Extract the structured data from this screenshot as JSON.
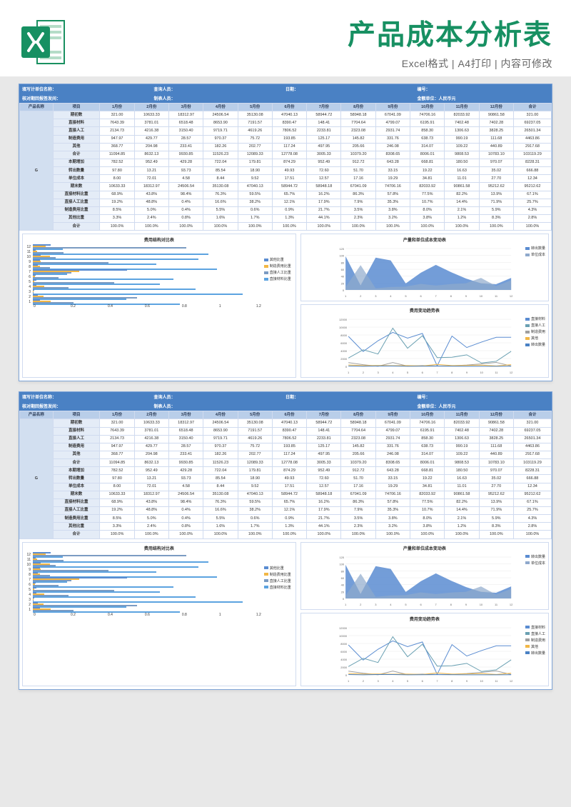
{
  "header": {
    "title": "产品成本分析表",
    "subtitle": "Excel格式 | A4打印 | 内容可修改",
    "icon_name": "excel-icon"
  },
  "band": {
    "a": "填写计单位名称：",
    "b": "查询人员：",
    "c": "日期：",
    "d": "编号：",
    "e": "核对期回报签发间：",
    "f": "制表人员：",
    "g": "",
    "h": "金额单位：人民币元"
  },
  "columns": [
    "产品名称",
    "项目",
    "1月份",
    "2月份",
    "3月份",
    "4月份",
    "5月份",
    "6月份",
    "7月份",
    "8月份",
    "9月份",
    "10月份",
    "11月份",
    "12月份",
    "合计"
  ],
  "product": "G",
  "rows": [
    {
      "n": "期初数",
      "v": [
        "321.00",
        "10633.33",
        "18312.97",
        "24506.54",
        "35130.08",
        "47040.13",
        "58944.72",
        "58948.18",
        "67041.09",
        "74706.16",
        "82033.92",
        "90861.58",
        "321.00"
      ]
    },
    {
      "n": "直接材料",
      "v": [
        "7643.39",
        "3781.01",
        "6518.48",
        "8653.90",
        "7191.57",
        "8390.47",
        "148.41",
        "7704.64",
        "4799.07",
        "6195.91",
        "7402.48",
        "7402.28",
        "69237.05"
      ]
    },
    {
      "n": "直接人工",
      "v": [
        "2134.73",
        "4216.38",
        "3150.40",
        "9719.71",
        "4619.26",
        "7806.52",
        "2233.81",
        "2323.08",
        "2931.74",
        "858.30",
        "1306.63",
        "3828.25",
        "26501.34"
      ]
    },
    {
      "n": "制造费用",
      "v": [
        "947.97",
        "429.77",
        "28.57",
        "970.37",
        "75.72",
        "193.85",
        "125.17",
        "145.82",
        "331.76",
        "638.73",
        "990.19",
        "111.68",
        "4463.86"
      ]
    },
    {
      "n": "其他",
      "v": [
        "368.77",
        "204.98",
        "233.41",
        "182.26",
        "202.77",
        "117.24",
        "497.95",
        "205.66",
        "246.08",
        "314.07",
        "109.22",
        "440.89",
        "2917.68"
      ]
    },
    {
      "n": "合计",
      "v": [
        "11094.85",
        "8632.13",
        "9930.85",
        "11526.23",
        "12089.33",
        "12778.08",
        "3005.33",
        "10379.20",
        "8308.65",
        "8006.01",
        "9808.53",
        "10783.10",
        "103119.29"
      ]
    },
    {
      "n": "本期增加",
      "v": [
        "782.52",
        "952.49",
        "429.28",
        "722.04",
        "179.81",
        "874.29",
        "952.49",
        "912.72",
        "643.28",
        "668.81",
        "180.50",
        "970.07",
        "8228.31"
      ]
    },
    {
      "n": "转出数量",
      "v": [
        "97.80",
        "13.21",
        "93.73",
        "85.54",
        "18.90",
        "49.93",
        "72.60",
        "51.70",
        "33.15",
        "19.22",
        "16.63",
        "35.02",
        "666.88"
      ]
    },
    {
      "n": "单位成本",
      "v": [
        "8.00",
        "72.01",
        "4.58",
        "8.44",
        "9.52",
        "17.51",
        "12.57",
        "17.16",
        "19.29",
        "34.81",
        "11.01",
        "27.70",
        "12.34"
      ]
    },
    {
      "n": "期末数",
      "v": [
        "10633.33",
        "18312.97",
        "24506.54",
        "35130.08",
        "47040.13",
        "58944.72",
        "58948.18",
        "67041.09",
        "74706.16",
        "82033.92",
        "90861.58",
        "95212.62",
        "95212.62"
      ]
    },
    {
      "n": "直接材料比重",
      "v": [
        "68.9%",
        "43.8%",
        "98.4%",
        "76.3%",
        "59.5%",
        "65.7%",
        "16.2%",
        "86.3%",
        "57.8%",
        "77.5%",
        "82.2%",
        "13.9%",
        "67.1%"
      ]
    },
    {
      "n": "直接人工比重",
      "v": [
        "19.2%",
        "48.8%",
        "0.4%",
        "16.6%",
        "38.2%",
        "12.1%",
        "17.9%",
        "7.9%",
        "35.3%",
        "10.7%",
        "14.4%",
        "71.9%",
        "25.7%"
      ]
    },
    {
      "n": "制造费用比重",
      "v": [
        "8.5%",
        "5.0%",
        "0.4%",
        "5.5%",
        "0.6%",
        "0.9%",
        "21.7%",
        "3.5%",
        "3.8%",
        "8.0%",
        "2.1%",
        "5.9%",
        "4.3%"
      ]
    },
    {
      "n": "其他比重",
      "v": [
        "3.3%",
        "2.4%",
        "0.8%",
        "1.6%",
        "1.7%",
        "1.3%",
        "44.1%",
        "2.3%",
        "3.2%",
        "3.8%",
        "1.2%",
        "8.3%",
        "2.8%"
      ]
    },
    {
      "n": "合计",
      "v": [
        "100.0%",
        "100.0%",
        "100.0%",
        "100.0%",
        "100.0%",
        "100.0%",
        "100.0%",
        "100.0%",
        "100.0%",
        "100.0%",
        "100.0%",
        "100.0%",
        "100.0%"
      ]
    }
  ],
  "chart_data": [
    {
      "type": "bar",
      "title": "费用结构对比表",
      "orientation": "horizontal",
      "categories": [
        1,
        2,
        3,
        4,
        5,
        6,
        7,
        8,
        9,
        10,
        11,
        12
      ],
      "series": [
        {
          "name": "其他比重",
          "values": [
            0.033,
            0.024,
            0.008,
            0.016,
            0.017,
            0.013,
            0.441,
            0.023,
            0.032,
            0.038,
            0.012,
            0.083
          ]
        },
        {
          "name": "制造费用比重",
          "values": [
            0.085,
            0.05,
            0.004,
            0.055,
            0.006,
            0.009,
            0.217,
            0.035,
            0.038,
            0.08,
            0.021,
            0.059
          ]
        },
        {
          "name": "直接人工比重",
          "values": [
            0.192,
            0.488,
            0.004,
            0.166,
            0.382,
            0.121,
            0.179,
            0.079,
            0.353,
            0.107,
            0.144,
            0.719
          ]
        },
        {
          "name": "直接材料比重",
          "values": [
            0.689,
            0.438,
            0.984,
            0.763,
            0.595,
            0.657,
            0.162,
            0.863,
            0.578,
            0.775,
            0.822,
            0.139
          ]
        }
      ],
      "xlabel": "",
      "ylabel": "",
      "xlim": [
        0,
        1.2
      ]
    },
    {
      "type": "area",
      "title": "产量和单位成本变动表",
      "x": [
        1,
        2,
        3,
        4,
        5,
        6,
        7,
        8,
        9,
        10,
        11,
        12
      ],
      "series": [
        {
          "name": "转出数量",
          "values": [
            97.8,
            13.21,
            93.73,
            85.54,
            18.9,
            49.93,
            72.6,
            51.7,
            33.15,
            19.22,
            16.63,
            35.02
          ]
        },
        {
          "name": "单位成本",
          "values": [
            8,
            72.01,
            4.58,
            8.44,
            9.52,
            17.51,
            12.57,
            17.16,
            19.29,
            34.81,
            11.01,
            27.7
          ]
        }
      ],
      "ylim": [
        0,
        120
      ]
    },
    {
      "type": "line",
      "title": "费用变动趋势表",
      "x": [
        1,
        2,
        3,
        4,
        5,
        6,
        7,
        8,
        9,
        10,
        11,
        12
      ],
      "series": [
        {
          "name": "直接材料",
          "values": [
            7643,
            3781,
            6518,
            8654,
            7192,
            8390,
            148,
            7705,
            4799,
            6196,
            7402,
            7402
          ]
        },
        {
          "name": "直接人工",
          "values": [
            2135,
            4216,
            3150,
            9720,
            4619,
            7807,
            2234,
            2323,
            2932,
            858,
            1307,
            3828
          ]
        },
        {
          "name": "制造费用",
          "values": [
            948,
            430,
            29,
            970,
            76,
            194,
            125,
            146,
            332,
            639,
            990,
            112
          ]
        },
        {
          "name": "其他",
          "values": [
            369,
            205,
            233,
            182,
            203,
            117,
            498,
            206,
            246,
            314,
            109,
            441
          ]
        },
        {
          "name": "转出数量",
          "values": [
            98,
            13,
            94,
            86,
            19,
            50,
            73,
            52,
            33,
            19,
            17,
            35
          ]
        }
      ],
      "ylim": [
        0,
        12000
      ]
    }
  ]
}
